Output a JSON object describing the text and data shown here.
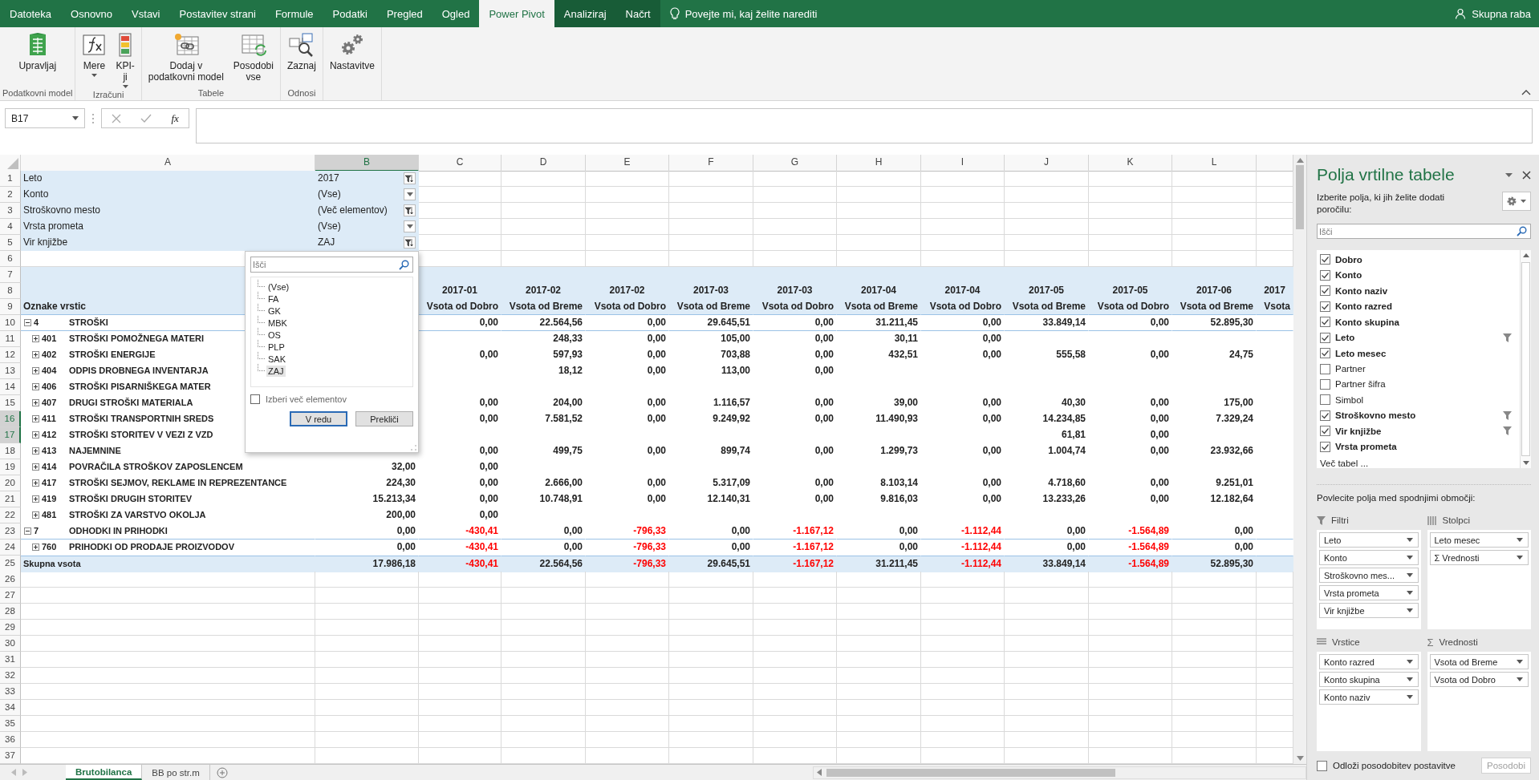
{
  "ribbon_tabs": [
    {
      "label": "Datoteka",
      "selected": false,
      "contextual": false
    },
    {
      "label": "Osnovno",
      "selected": false,
      "contextual": false
    },
    {
      "label": "Vstavi",
      "selected": false,
      "contextual": false
    },
    {
      "label": "Postavitev strani",
      "selected": false,
      "contextual": false
    },
    {
      "label": "Formule",
      "selected": false,
      "contextual": false
    },
    {
      "label": "Podatki",
      "selected": false,
      "contextual": false
    },
    {
      "label": "Pregled",
      "selected": false,
      "contextual": false
    },
    {
      "label": "Ogled",
      "selected": false,
      "contextual": false
    },
    {
      "label": "Power Pivot",
      "selected": true,
      "contextual": false
    },
    {
      "label": "Analiziraj",
      "selected": false,
      "contextual": true
    },
    {
      "label": "Načrt",
      "selected": false,
      "contextual": true
    }
  ],
  "tell_me": "Povejte mi, kaj želite narediti",
  "share": "Skupna raba",
  "ribbon_groups": [
    {
      "label": "Podatkovni model",
      "buttons": [
        {
          "kind": "manage",
          "label": "Upravljaj",
          "dropdown": false
        }
      ]
    },
    {
      "label": "Izračuni",
      "buttons": [
        {
          "kind": "measures",
          "label": "Mere",
          "dropdown": true
        },
        {
          "kind": "kpi",
          "label": "KPI-\nji",
          "dropdown": true
        }
      ]
    },
    {
      "label": "Tabele",
      "buttons": [
        {
          "kind": "add-table",
          "label": "Dodaj v\npodatkovni model",
          "dropdown": false
        },
        {
          "kind": "refresh",
          "label": "Posodobi\nvse",
          "dropdown": false
        }
      ]
    },
    {
      "label": "Odnosi",
      "buttons": [
        {
          "kind": "detect",
          "label": "Zaznaj",
          "dropdown": false
        }
      ]
    },
    {
      "buttons": [
        {
          "kind": "settings",
          "label": "Nastavitve",
          "dropdown": false
        }
      ]
    }
  ],
  "formula_bar": {
    "name_box": "B17",
    "fx": "fx"
  },
  "grid": {
    "column_headers": [
      {
        "label": "A",
        "selected": false
      },
      {
        "label": "B",
        "selected": true
      },
      {
        "label": "C",
        "selected": false
      },
      {
        "label": "D",
        "selected": false
      },
      {
        "label": "E",
        "selected": false
      },
      {
        "label": "F",
        "selected": false
      },
      {
        "label": "G",
        "selected": false
      },
      {
        "label": "H",
        "selected": false
      },
      {
        "label": "I",
        "selected": false
      },
      {
        "label": "J",
        "selected": false
      },
      {
        "label": "K",
        "selected": false
      },
      {
        "label": "L",
        "selected": false
      }
    ],
    "row_numbers": [
      {
        "label": "1",
        "selected": false
      },
      {
        "label": "2",
        "selected": false
      },
      {
        "label": "3",
        "selected": false
      },
      {
        "label": "4",
        "selected": false
      },
      {
        "label": "5",
        "selected": false
      },
      {
        "label": "6",
        "selected": false
      },
      {
        "label": "7",
        "selected": false
      },
      {
        "label": "8",
        "selected": false
      },
      {
        "label": "9",
        "selected": false
      },
      {
        "label": "10",
        "selected": false
      },
      {
        "label": "11",
        "selected": false
      },
      {
        "label": "12",
        "selected": false
      },
      {
        "label": "13",
        "selected": false
      },
      {
        "label": "14",
        "selected": false
      },
      {
        "label": "15",
        "selected": false
      },
      {
        "label": "16",
        "selected": true
      },
      {
        "label": "17",
        "selected": true
      },
      {
        "label": "18",
        "selected": false
      },
      {
        "label": "19",
        "selected": false
      },
      {
        "label": "20",
        "selected": false
      },
      {
        "label": "21",
        "selected": false
      },
      {
        "label": "22",
        "selected": false
      },
      {
        "label": "23",
        "selected": false
      },
      {
        "label": "24",
        "selected": false
      },
      {
        "label": "25",
        "selected": false
      },
      {
        "label": "26",
        "selected": false
      },
      {
        "label": "27",
        "selected": false
      },
      {
        "label": "28",
        "selected": false
      },
      {
        "label": "29",
        "selected": false
      },
      {
        "label": "30",
        "selected": false
      },
      {
        "label": "31",
        "selected": false
      },
      {
        "label": "32",
        "selected": false
      },
      {
        "label": "33",
        "selected": false
      },
      {
        "label": "34",
        "selected": false
      },
      {
        "label": "35",
        "selected": false
      },
      {
        "label": "36",
        "selected": false
      },
      {
        "label": "37",
        "selected": false
      }
    ]
  },
  "pivot": {
    "filters": [
      {
        "label": "Leto",
        "value": "2017",
        "filtered": true
      },
      {
        "label": "Konto",
        "value": "(Vse)",
        "filtered": false
      },
      {
        "label": "Stroškovno mesto",
        "value": "(Več elementov)",
        "filtered": true
      },
      {
        "label": "Vrsta prometa",
        "value": "(Vse)",
        "filtered": false
      },
      {
        "label": "Vir knjižbe",
        "value": "ZAJ",
        "filtered": true
      }
    ],
    "row_labels_header": "Oznake vrstic",
    "column_months": [
      "2017-01",
      "2017-02",
      "2017-02",
      "2017-03",
      "2017-03",
      "2017-04",
      "2017-04",
      "2017-05",
      "2017-05",
      "2017-06",
      "2017"
    ],
    "column_measures": [
      "Vsota od Dobro",
      "Vsota od Breme",
      "Vsota od Dobro",
      "Vsota od Breme",
      "Vsota od Dobro",
      "Vsota od Breme",
      "Vsota od Dobro",
      "Vsota od Breme",
      "Vsota od Dobro",
      "Vsota od Breme",
      "Vsota"
    ],
    "groups": [
      {
        "code": "4",
        "label": "STROŠKI",
        "expanded": true,
        "values": {
          "C": "0,00",
          "D": "22.564,56",
          "E": "0,00",
          "F": "29.645,51",
          "G": "0,00",
          "H": "31.211,45",
          "I": "0,00",
          "J": "33.849,14",
          "K": "0,00",
          "L": "52.895,30"
        },
        "children": [
          {
            "code": "401",
            "label": "STROŠKI POMOŽNEGA MATERI",
            "expanded": false,
            "values": {
              "D": "248,33",
              "E": "0,00",
              "F": "105,00",
              "G": "0,00",
              "H": "30,11",
              "I": "0,00"
            }
          },
          {
            "code": "402",
            "label": "STROŠKI ENERGIJE",
            "expanded": false,
            "values": {
              "C": "0,00",
              "D": "597,93",
              "E": "0,00",
              "F": "703,88",
              "G": "0,00",
              "H": "432,51",
              "I": "0,00",
              "J": "555,58",
              "K": "0,00",
              "L": "24,75"
            }
          },
          {
            "code": "404",
            "label": "ODPIS DROBNEGA INVENTARJA",
            "expanded": false,
            "values": {
              "D": "18,12",
              "E": "0,00",
              "F": "113,00",
              "G": "0,00"
            }
          },
          {
            "code": "406",
            "label": "STROŠKI PISARNIŠKEGA MATER",
            "expanded": false
          },
          {
            "code": "407",
            "label": "DRUGI STROŠKI MATERIALA",
            "expanded": false,
            "values": {
              "C": "0,00",
              "D": "204,00",
              "E": "0,00",
              "F": "1.116,57",
              "G": "0,00",
              "H": "39,00",
              "I": "0,00",
              "J": "40,30",
              "K": "0,00",
              "L": "175,00"
            }
          },
          {
            "code": "411",
            "label": "STROŠKI TRANSPORTNIH SREDS",
            "expanded": false,
            "values": {
              "C": "0,00",
              "D": "7.581,52",
              "E": "0,00",
              "F": "9.249,92",
              "G": "0,00",
              "H": "11.490,93",
              "I": "0,00",
              "J": "14.234,85",
              "K": "0,00",
              "L": "7.329,24"
            }
          },
          {
            "code": "412",
            "label": "STROŠKI STORITEV V VEZI Z VZD",
            "expanded": false,
            "values": {
              "J": "61,81",
              "K": "0,00"
            }
          },
          {
            "code": "413",
            "label": "NAJEMNINE",
            "expanded": false,
            "values": {
              "C": "0,00",
              "D": "499,75",
              "E": "0,00",
              "F": "899,74",
              "G": "0,00",
              "H": "1.299,73",
              "I": "0,00",
              "J": "1.004,74",
              "K": "0,00",
              "L": "23.932,66"
            }
          },
          {
            "code": "414",
            "label": "POVRAČILA STROŠKOV ZAPOSLENCEM",
            "expanded": false,
            "values": {
              "B": "32,00",
              "C": "0,00"
            }
          },
          {
            "code": "417",
            "label": "STROŠKI SEJMOV, REKLAME IN REPREZENTANCE",
            "expanded": false,
            "values": {
              "B": "224,30",
              "C": "0,00",
              "D": "2.666,00",
              "E": "0,00",
              "F": "5.317,09",
              "G": "0,00",
              "H": "8.103,14",
              "I": "0,00",
              "J": "4.718,60",
              "K": "0,00",
              "L": "9.251,01"
            }
          },
          {
            "code": "419",
            "label": "STROŠKI DRUGIH STORITEV",
            "expanded": false,
            "values": {
              "B": "15.213,34",
              "C": "0,00",
              "D": "10.748,91",
              "E": "0,00",
              "F": "12.140,31",
              "G": "0,00",
              "H": "9.816,03",
              "I": "0,00",
              "J": "13.233,26",
              "K": "0,00",
              "L": "12.182,64"
            }
          },
          {
            "code": "481",
            "label": "STROŠKI ZA VARSTVO OKOLJA",
            "expanded": false,
            "values": {
              "B": "200,00",
              "C": "0,00"
            }
          }
        ]
      },
      {
        "code": "7",
        "label": "ODHODKI IN PRIHODKI",
        "expanded": true,
        "values": {
          "B": "0,00",
          "C": "-430,41",
          "D": "0,00",
          "E": "-796,33",
          "F": "0,00",
          "G": "-1.167,12",
          "H": "0,00",
          "I": "-1.112,44",
          "J": "0,00",
          "K": "-1.564,89",
          "L": "0,00"
        },
        "children": [
          {
            "code": "760",
            "label": "PRIHODKI OD PRODAJE PROIZVODOV",
            "expanded": false,
            "values": {
              "B": "0,00",
              "C": "-430,41",
              "D": "0,00",
              "E": "-796,33",
              "F": "0,00",
              "G": "-1.167,12",
              "H": "0,00",
              "I": "-1.112,44",
              "J": "0,00",
              "K": "-1.564,89",
              "L": "0,00"
            }
          }
        ]
      }
    ],
    "total": {
      "label": "Skupna vsota",
      "values": {
        "B": "17.986,18",
        "C": "-430,41",
        "D": "22.564,56",
        "E": "-796,33",
        "F": "29.645,51",
        "G": "-1.167,12",
        "H": "31.211,45",
        "I": "-1.112,44",
        "J": "33.849,14",
        "K": "-1.564,89",
        "L": "52.895,30"
      }
    }
  },
  "filter_popup": {
    "search_placeholder": "Išči",
    "items": [
      {
        "label": "(Vse)",
        "selected": false
      },
      {
        "label": "FA",
        "selected": false
      },
      {
        "label": "GK",
        "selected": false
      },
      {
        "label": "MBK",
        "selected": false
      },
      {
        "label": "OS",
        "selected": false
      },
      {
        "label": "PLP",
        "selected": false
      },
      {
        "label": "SAK",
        "selected": false
      },
      {
        "label": "ZAJ",
        "selected": true
      }
    ],
    "multi_select": {
      "label": "Izberi več elementov",
      "checked": false
    },
    "buttons": [
      {
        "label": "V redu",
        "default": true
      },
      {
        "label": "Prekliči",
        "default": false
      }
    ]
  },
  "sheet_tabs": [
    {
      "label": "Brutobilanca",
      "selected": true
    },
    {
      "label": "BB po str.m",
      "selected": false
    }
  ],
  "field_pane": {
    "title": "Polja vrtilne tabele",
    "instruction": "Izberite polja, ki jih želite dodati poročilu:",
    "search_placeholder": "Išči",
    "fields": [
      {
        "label": "Dobro",
        "checked": true,
        "filtered": false
      },
      {
        "label": "Konto",
        "checked": true,
        "filtered": false
      },
      {
        "label": "Konto naziv",
        "checked": true,
        "filtered": false
      },
      {
        "label": "Konto razred",
        "checked": true,
        "filtered": false
      },
      {
        "label": "Konto skupina",
        "checked": true,
        "filtered": false
      },
      {
        "label": "Leto",
        "checked": true,
        "filtered": true
      },
      {
        "label": "Leto mesec",
        "checked": true,
        "filtered": false
      },
      {
        "label": "Partner",
        "checked": false,
        "filtered": false
      },
      {
        "label": "Partner šifra",
        "checked": false,
        "filtered": false
      },
      {
        "label": "Simbol",
        "checked": false,
        "filtered": false
      },
      {
        "label": "Stroškovno mesto",
        "checked": true,
        "filtered": true
      },
      {
        "label": "Vir knjižbe",
        "checked": true,
        "filtered": true
      },
      {
        "label": "Vrsta prometa",
        "checked": true,
        "filtered": false
      }
    ],
    "more_tables": "Več tabel ...",
    "drag_hint": "Povlecite polja med spodnjimi območji:",
    "areas": [
      {
        "kind": "filters",
        "title": "Filtri",
        "fields": [
          "Leto",
          "Konto",
          "Stroškovno mes...",
          "Vrsta prometa",
          "Vir knjižbe"
        ]
      },
      {
        "kind": "columns",
        "title": "Stolpci",
        "fields": [
          "Leto mesec",
          "Σ Vrednosti"
        ]
      },
      {
        "kind": "rows",
        "title": "Vrstice",
        "fields": [
          "Konto razred",
          "Konto skupina",
          "Konto naziv"
        ]
      },
      {
        "kind": "values",
        "title": "Vrednosti",
        "symbol": "Σ",
        "fields": [
          "Vsota od Breme",
          "Vsota od Dobro"
        ]
      }
    ],
    "defer": {
      "label": "Odloži posodobitev postavitve",
      "checked": false
    },
    "update_button": {
      "label": "Posodobi",
      "disabled": true
    }
  }
}
